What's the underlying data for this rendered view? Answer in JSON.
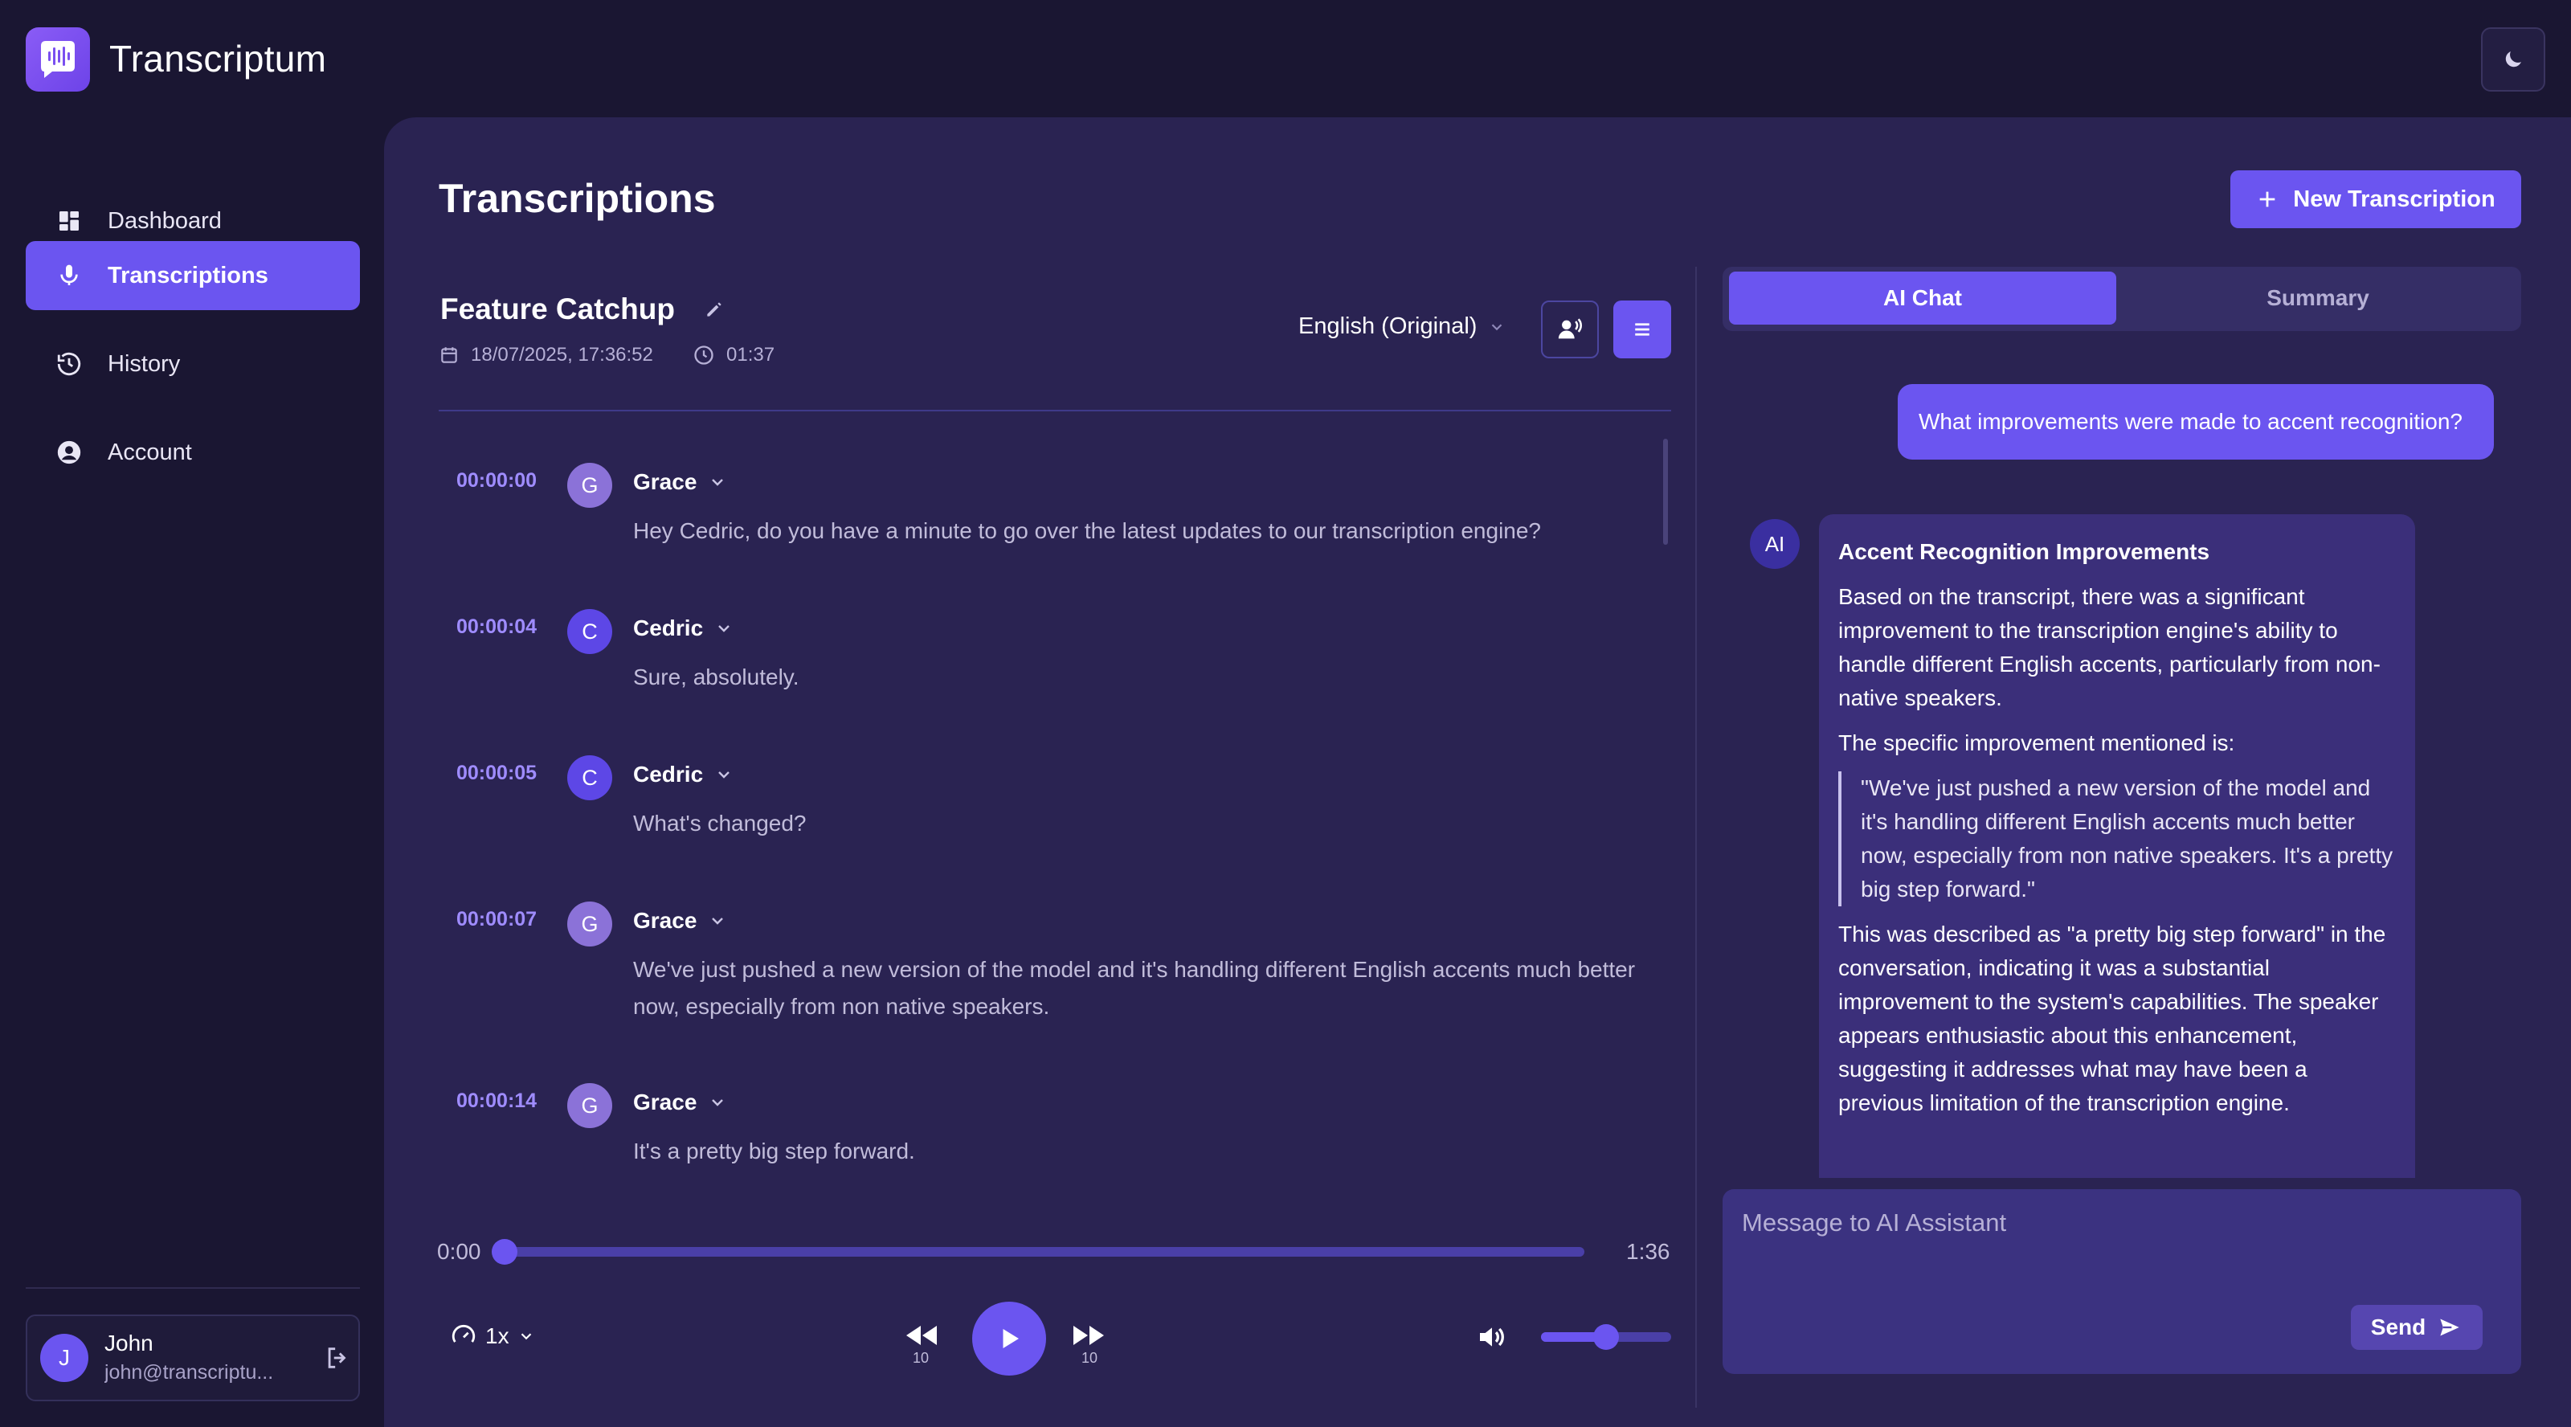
{
  "app": {
    "title": "Transcriptum"
  },
  "sidebar": {
    "items": [
      {
        "label": "Dashboard",
        "icon": "dashboard-icon",
        "active": false
      },
      {
        "label": "Transcriptions",
        "icon": "microphone-icon",
        "active": true
      },
      {
        "label": "History",
        "icon": "history-icon",
        "active": false
      },
      {
        "label": "Account",
        "icon": "account-icon",
        "active": false
      }
    ],
    "user": {
      "initial": "J",
      "name": "John",
      "email": "john@transcriptu..."
    }
  },
  "main": {
    "title": "Transcriptions",
    "new_button_label": "New Transcription"
  },
  "transcription": {
    "title": "Feature Catchup",
    "date": "18/07/2025, 17:36:52",
    "duration": "01:37",
    "language": "English (Original)",
    "segments": [
      {
        "time": "00:00:00",
        "initial": "G",
        "speaker": "Grace",
        "text": "Hey Cedric, do you have a minute to go over the latest updates to our transcription engine?"
      },
      {
        "time": "00:00:04",
        "initial": "C",
        "speaker": "Cedric",
        "text": "Sure, absolutely."
      },
      {
        "time": "00:00:05",
        "initial": "C",
        "speaker": "Cedric",
        "text": "What's changed?"
      },
      {
        "time": "00:00:07",
        "initial": "G",
        "speaker": "Grace",
        "text": "We've just pushed a new version of the model and it's handling different English accents much better now, especially from non native speakers."
      },
      {
        "time": "00:00:14",
        "initial": "G",
        "speaker": "Grace",
        "text": "It's a pretty big step forward."
      }
    ]
  },
  "player": {
    "current_time": "0:00",
    "total_time": "1:36",
    "progress": 0,
    "speed": "1x",
    "skip_back": "10",
    "skip_forward": "10",
    "volume": 0.5
  },
  "chat": {
    "tabs": [
      "AI Chat",
      "Summary"
    ],
    "active_tab": "AI Chat",
    "user_message": "What improvements were made to accent recognition?",
    "ai_avatar": "AI",
    "ai_response": {
      "heading": "Accent Recognition Improvements",
      "p1": "Based on the transcript, there was a significant improvement to the transcription engine's ability to handle different English accents, particularly from non-native speakers.",
      "p2": "The specific improvement mentioned is:",
      "quote": "\"We've just pushed a new version of the model and it's handling different English accents much better now, especially from non native speakers. It's a pretty big step forward.\"",
      "p3": "This was described as \"a pretty big step forward\" in the conversation, indicating it was a substantial improvement to the system's capabilities. The speaker appears enthusiastic about this enhancement, suggesting it addresses what may have been a previous limitation of the transcription engine."
    },
    "input_placeholder": "Message to AI Assistant",
    "send_label": "Send"
  },
  "colors": {
    "accent": "#6b55f0",
    "background": "#1a1632",
    "panel": "#2a2352",
    "timestamp": "#9f8cff"
  }
}
